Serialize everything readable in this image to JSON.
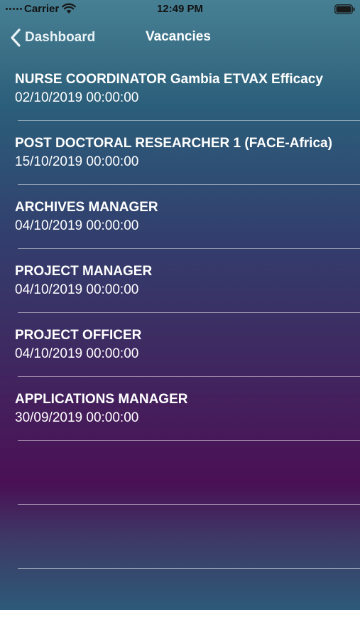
{
  "status_bar": {
    "carrier": "Carrier",
    "time": "12:49 PM",
    "icons": [
      "signal-dots-icon",
      "wifi-icon",
      "battery-icon"
    ]
  },
  "nav": {
    "back_label": "Dashboard",
    "back_icon": "chevron-left-icon",
    "title": "Vacancies"
  },
  "vacancies": [
    {
      "title": "NURSE COORDINATOR Gambia ETVAX Efficacy",
      "date": "02/10/2019 00:00:00"
    },
    {
      "title": "POST DOCTORAL RESEARCHER 1 (FACE-Africa)",
      "date": "15/10/2019 00:00:00"
    },
    {
      "title": "ARCHIVES MANAGER",
      "date": "04/10/2019 00:00:00"
    },
    {
      "title": "PROJECT MANAGER",
      "date": "04/10/2019 00:00:00"
    },
    {
      "title": "PROJECT OFFICER",
      "date": "04/10/2019 00:00:00"
    },
    {
      "title": "APPLICATIONS MANAGER",
      "date": "30/09/2019 00:00:00"
    },
    {
      "title": "",
      "date": ""
    },
    {
      "title": "",
      "date": ""
    }
  ],
  "colors": {
    "gradient_top": "#467f93",
    "gradient_middle": "#4a1055",
    "gradient_bottom": "#2d5a78",
    "text": "#ffffff"
  }
}
